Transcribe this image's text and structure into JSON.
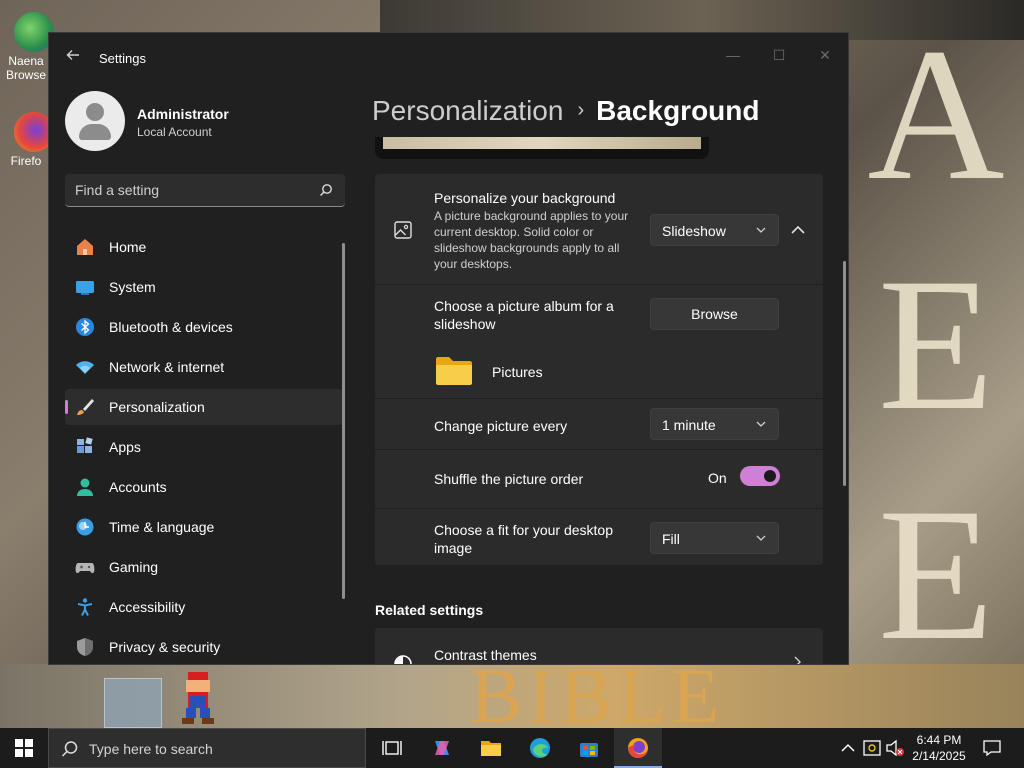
{
  "desktop": {
    "icons": [
      {
        "label": "Naena Browse",
        "icon": "globe-shortcut-icon"
      },
      {
        "label": "Firefo",
        "icon": "firefox-shortcut-icon"
      }
    ],
    "wallpaper_letters": [
      "A",
      "E",
      "E"
    ],
    "wallpaper_bottom_text": "BIBLE"
  },
  "window": {
    "title": "Settings",
    "controls": {
      "minimize": "—",
      "maximize": "☐",
      "close": "✕"
    }
  },
  "profile": {
    "name": "Administrator",
    "account_type": "Local Account"
  },
  "search": {
    "placeholder": "Find a setting"
  },
  "nav": {
    "items": [
      {
        "label": "Home",
        "icon": "home-icon"
      },
      {
        "label": "System",
        "icon": "system-icon"
      },
      {
        "label": "Bluetooth & devices",
        "icon": "bluetooth-icon"
      },
      {
        "label": "Network & internet",
        "icon": "network-icon"
      },
      {
        "label": "Personalization",
        "icon": "brush-icon",
        "active": true
      },
      {
        "label": "Apps",
        "icon": "apps-icon"
      },
      {
        "label": "Accounts",
        "icon": "accounts-icon"
      },
      {
        "label": "Time & language",
        "icon": "time-language-icon"
      },
      {
        "label": "Gaming",
        "icon": "gaming-icon"
      },
      {
        "label": "Accessibility",
        "icon": "accessibility-icon"
      },
      {
        "label": "Privacy & security",
        "icon": "shield-icon"
      }
    ]
  },
  "breadcrumb": {
    "parent": "Personalization",
    "separator": "›",
    "current": "Background"
  },
  "background": {
    "personalize": {
      "title": "Personalize your background",
      "description": "A picture background applies to your current desktop. Solid color or slideshow backgrounds apply to all your desktops.",
      "value": "Slideshow"
    },
    "album": {
      "label": "Choose a picture album for a slideshow",
      "button": "Browse",
      "folder": "Pictures"
    },
    "change_every": {
      "label": "Change picture every",
      "value": "1 minute"
    },
    "shuffle": {
      "label": "Shuffle the picture order",
      "state": "On"
    },
    "fit": {
      "label": "Choose a fit for your desktop image",
      "value": "Fill"
    }
  },
  "related": {
    "title": "Related settings",
    "items": [
      {
        "label": "Contrast themes"
      }
    ]
  },
  "taskbar": {
    "search_placeholder": "Type here to search",
    "time": "6:44 PM",
    "date": "2/14/2025"
  },
  "colors": {
    "accent": "#d07fd6",
    "window_bg": "#202020",
    "card_bg": "#2b2b2b"
  }
}
